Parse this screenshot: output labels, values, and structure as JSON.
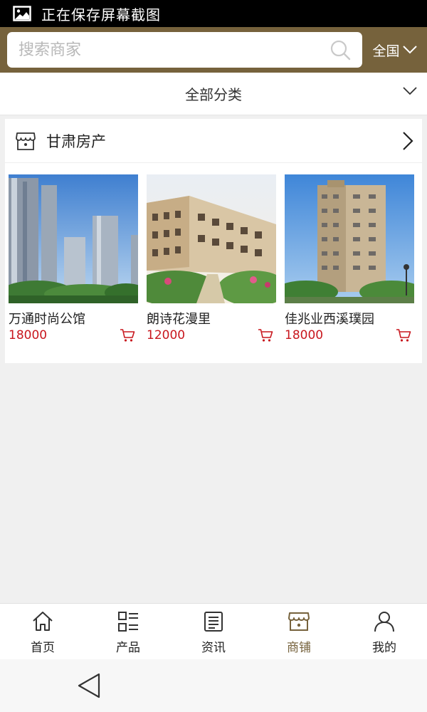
{
  "status_bar": {
    "text": "正在保存屏幕截图",
    "icon": "image-icon"
  },
  "header": {
    "search_placeholder": "搜索商家",
    "region_label": "全国",
    "accent_color": "#76623c"
  },
  "category": {
    "label": "全部分类"
  },
  "store": {
    "name": "甘肃房产",
    "products": [
      {
        "name": "万通时尚公馆",
        "price": "18000"
      },
      {
        "name": "朗诗花漫里",
        "price": "12000"
      },
      {
        "name": "佳兆业西溪璞园",
        "price": "18000"
      }
    ],
    "price_color": "#c8161d"
  },
  "tabs": [
    {
      "label": "首页",
      "icon": "home-icon",
      "active": false
    },
    {
      "label": "产品",
      "icon": "grid-list-icon",
      "active": false
    },
    {
      "label": "资讯",
      "icon": "news-icon",
      "active": false
    },
    {
      "label": "商铺",
      "icon": "shop-icon",
      "active": true
    },
    {
      "label": "我的",
      "icon": "user-icon",
      "active": false
    }
  ]
}
